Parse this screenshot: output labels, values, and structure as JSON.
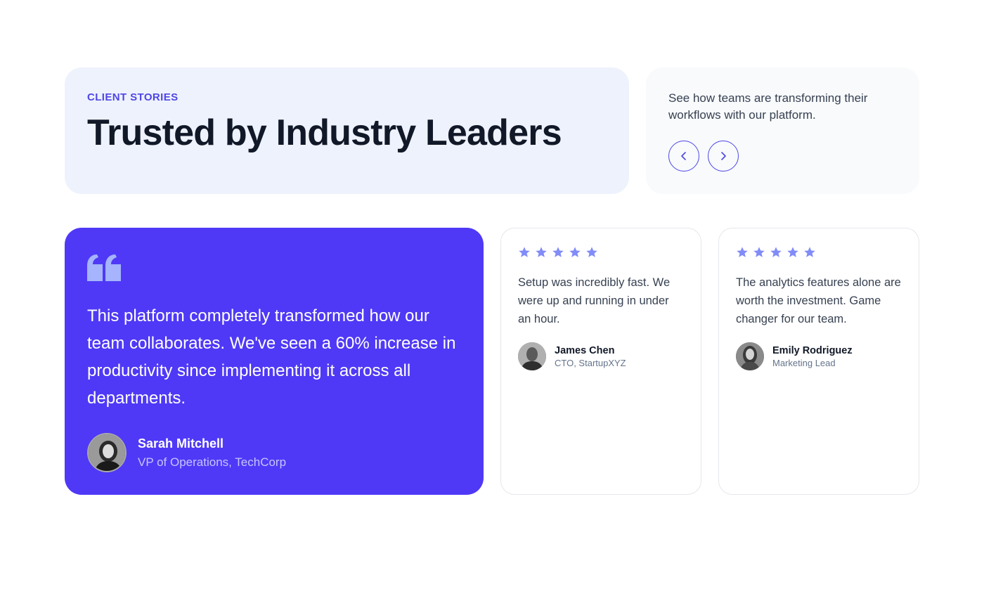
{
  "header": {
    "eyebrow": "CLIENT STORIES",
    "headline": "Trusted by Industry Leaders"
  },
  "intro": {
    "text": "See how teams are transforming their workflows with our platform.",
    "prev_icon": "chevron-left-icon",
    "next_icon": "chevron-right-icon"
  },
  "featured": {
    "quote_icon": "quote-icon",
    "quote": "This platform completely transformed how our team collaborates. We've seen a 60% increase in productivity since implementing it across all departments.",
    "author_name": "Sarah Mitchell",
    "author_role": "VP of Operations, TechCorp"
  },
  "testimonials": [
    {
      "rating": 5,
      "quote": "Setup was incredibly fast. We were up and running in under an hour.",
      "author_name": "James Chen",
      "author_role": "CTO, StartupXYZ"
    },
    {
      "rating": 5,
      "quote": "The analytics features alone are worth the investment. Game changer for our team.",
      "author_name": "Emily Rodriguez",
      "author_role": "Marketing Lead"
    }
  ],
  "colors": {
    "accent": "#4f46e5",
    "featured_bg": "#4f39f6",
    "header_bg": "#eef2fd",
    "intro_bg": "#f8fafc",
    "star": "#818cf8"
  }
}
